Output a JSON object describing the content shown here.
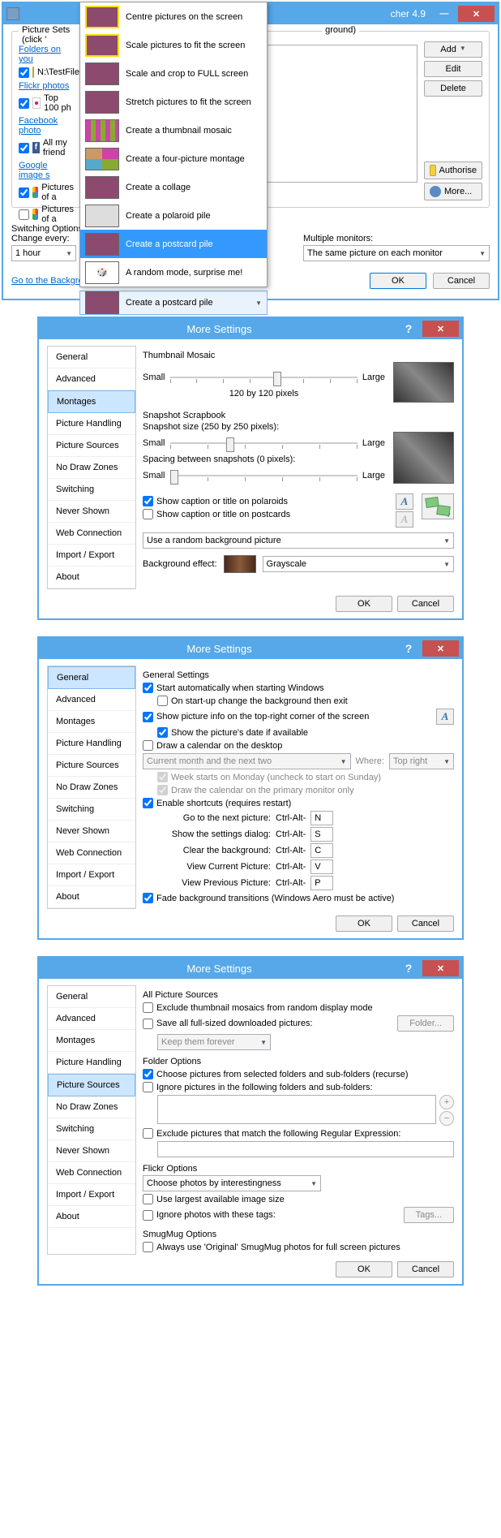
{
  "win1": {
    "title_suffix": "cher 4.9",
    "picture_sets_label": "Picture Sets (click '",
    "groupbox_right_suffix": "ground)",
    "folders_group": "Folders on you",
    "folder_item": "N:\\TestFiles",
    "flickr_group": "Flickr photos",
    "flickr_item": "Top 100 ph",
    "facebook_group": "Facebook photo",
    "facebook_item": "All my friend",
    "google_group": "Google image s",
    "google_item1": "Pictures of a",
    "google_item2": "Pictures of a",
    "add": "Add",
    "edit": "Edit",
    "delete": "Delete",
    "authorise": "Authorise",
    "more": "More...",
    "switching_options": "Switching Options",
    "change_every": "Change every:",
    "interval": "1 hour",
    "multiple_monitors": "Multiple monitors:",
    "monitor_mode": "The same picture on each monitor",
    "home_link": "Go to the Background Switcher homepage",
    "ok": "OK",
    "cancel": "Cancel",
    "modes": {
      "centre": "Centre pictures on the screen",
      "scale_fit": "Scale pictures to fit the screen",
      "scale_crop": "Scale and crop to FULL screen",
      "stretch": "Stretch pictures to fit the screen",
      "mosaic": "Create a thumbnail mosaic",
      "four_pic": "Create a four-picture montage",
      "collage": "Create a collage",
      "polaroid": "Create a polaroid pile",
      "postcard": "Create a postcard pile",
      "random": "A random mode, surprise me!",
      "closed": "Create a postcard pile"
    }
  },
  "tabs": {
    "general": "General",
    "advanced": "Advanced",
    "montages": "Montages",
    "picture_handling": "Picture Handling",
    "picture_sources": "Picture Sources",
    "no_draw": "No Draw Zones",
    "switching": "Switching",
    "never_shown": "Never Shown",
    "web_conn": "Web Connection",
    "import_export": "Import / Export",
    "about": "About"
  },
  "more_title": "More Settings",
  "ok": "OK",
  "cancel": "Cancel",
  "win2": {
    "thumbnail_mosaic": "Thumbnail Mosaic",
    "small": "Small",
    "large": "Large",
    "mosaic_size": "120 by 120 pixels",
    "snapshot": "Snapshot Scrapbook",
    "snapshot_size": "Snapshot size (250 by 250 pixels):",
    "spacing": "Spacing between snapshots (0 pixels):",
    "caption_polaroid": "Show caption or title on polaroids",
    "caption_postcard": "Show caption or title on postcards",
    "random_bg": "Use a random background picture",
    "bg_effect": "Background effect:",
    "grayscale": "Grayscale"
  },
  "win3": {
    "general_settings": "General Settings",
    "start_auto": "Start automatically when starting Windows",
    "startup_change": "On start-up change the background then exit",
    "show_info": "Show picture info on the top-right corner of the screen",
    "show_date": "Show the picture's date if available",
    "draw_calendar": "Draw a calendar on the desktop",
    "cal_months": "Current month and the next two",
    "where": "Where:",
    "top_right": "Top right",
    "week_monday": "Week starts on Monday (uncheck to start on Sunday)",
    "cal_primary": "Draw the calendar on the primary monitor only",
    "enable_shortcuts": "Enable shortcuts (requires restart)",
    "next_pic": "Go to the next picture:",
    "show_settings": "Show the settings dialog:",
    "clear_bg": "Clear the background:",
    "view_current": "View Current Picture:",
    "view_prev": "View Previous Picture:",
    "mod": "Ctrl-Alt-",
    "keys": {
      "n": "N",
      "s": "S",
      "c": "C",
      "v": "V",
      "p": "P"
    },
    "fade": "Fade background transitions (Windows Aero must be active)"
  },
  "win4": {
    "all_sources": "All Picture Sources",
    "exclude_mosaic": "Exclude thumbnail mosaics from random display mode",
    "save_full": "Save all full-sized downloaded pictures:",
    "folder_btn": "Folder...",
    "keep_forever": "Keep them forever",
    "folder_options": "Folder Options",
    "recurse": "Choose pictures from selected folders and sub-folders (recurse)",
    "ignore_folders": "Ignore pictures in the following folders and sub-folders:",
    "exclude_regex": "Exclude pictures that match the following Regular Expression:",
    "flickr_options": "Flickr Options",
    "interestingness": "Choose photos by interestingness",
    "largest": "Use largest available image size",
    "ignore_tags": "Ignore photos with these tags:",
    "tags_btn": "Tags...",
    "smugmug": "SmugMug Options",
    "smugmug_orig": "Always use 'Original' SmugMug photos for full screen pictures"
  }
}
